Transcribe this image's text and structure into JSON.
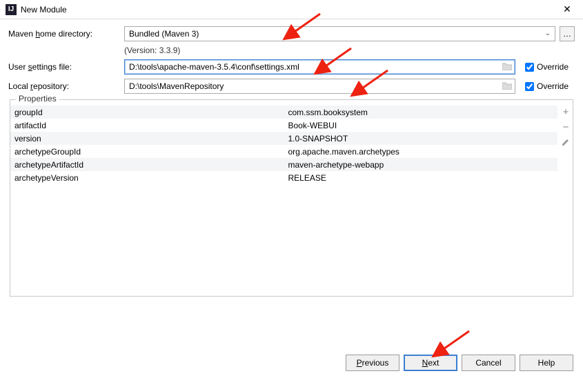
{
  "window": {
    "title": "New Module"
  },
  "labels": {
    "mavenHome_pre": "Maven ",
    "mavenHome_u": "h",
    "mavenHome_post": "ome directory:",
    "settings_pre": "User ",
    "settings_u": "s",
    "settings_post": "ettings file:",
    "repo_pre": "Local ",
    "repo_u": "r",
    "repo_post": "epository:",
    "override": "Override",
    "properties": "Properties"
  },
  "fields": {
    "mavenHome": "Bundled (Maven 3)",
    "versionText": "(Version: 3.3.9)",
    "settingsFile": "D:\\tools\\apache-maven-3.5.4\\conf\\settings.xml",
    "repository": "D:\\tools\\MavenRepository",
    "overrideSettings": true,
    "overrideRepo": true
  },
  "properties": [
    {
      "key": "groupId",
      "value": "com.ssm.booksystem"
    },
    {
      "key": "artifactId",
      "value": "Book-WEBUI"
    },
    {
      "key": "version",
      "value": "1.0-SNAPSHOT"
    },
    {
      "key": "archetypeGroupId",
      "value": "org.apache.maven.archetypes"
    },
    {
      "key": "archetypeArtifactId",
      "value": "maven-archetype-webapp"
    },
    {
      "key": "archetypeVersion",
      "value": "RELEASE"
    }
  ],
  "buttons": {
    "previous_u": "P",
    "previous_post": "revious",
    "next_u": "N",
    "next_post": "ext",
    "cancel": "Cancel",
    "help": "Help"
  }
}
